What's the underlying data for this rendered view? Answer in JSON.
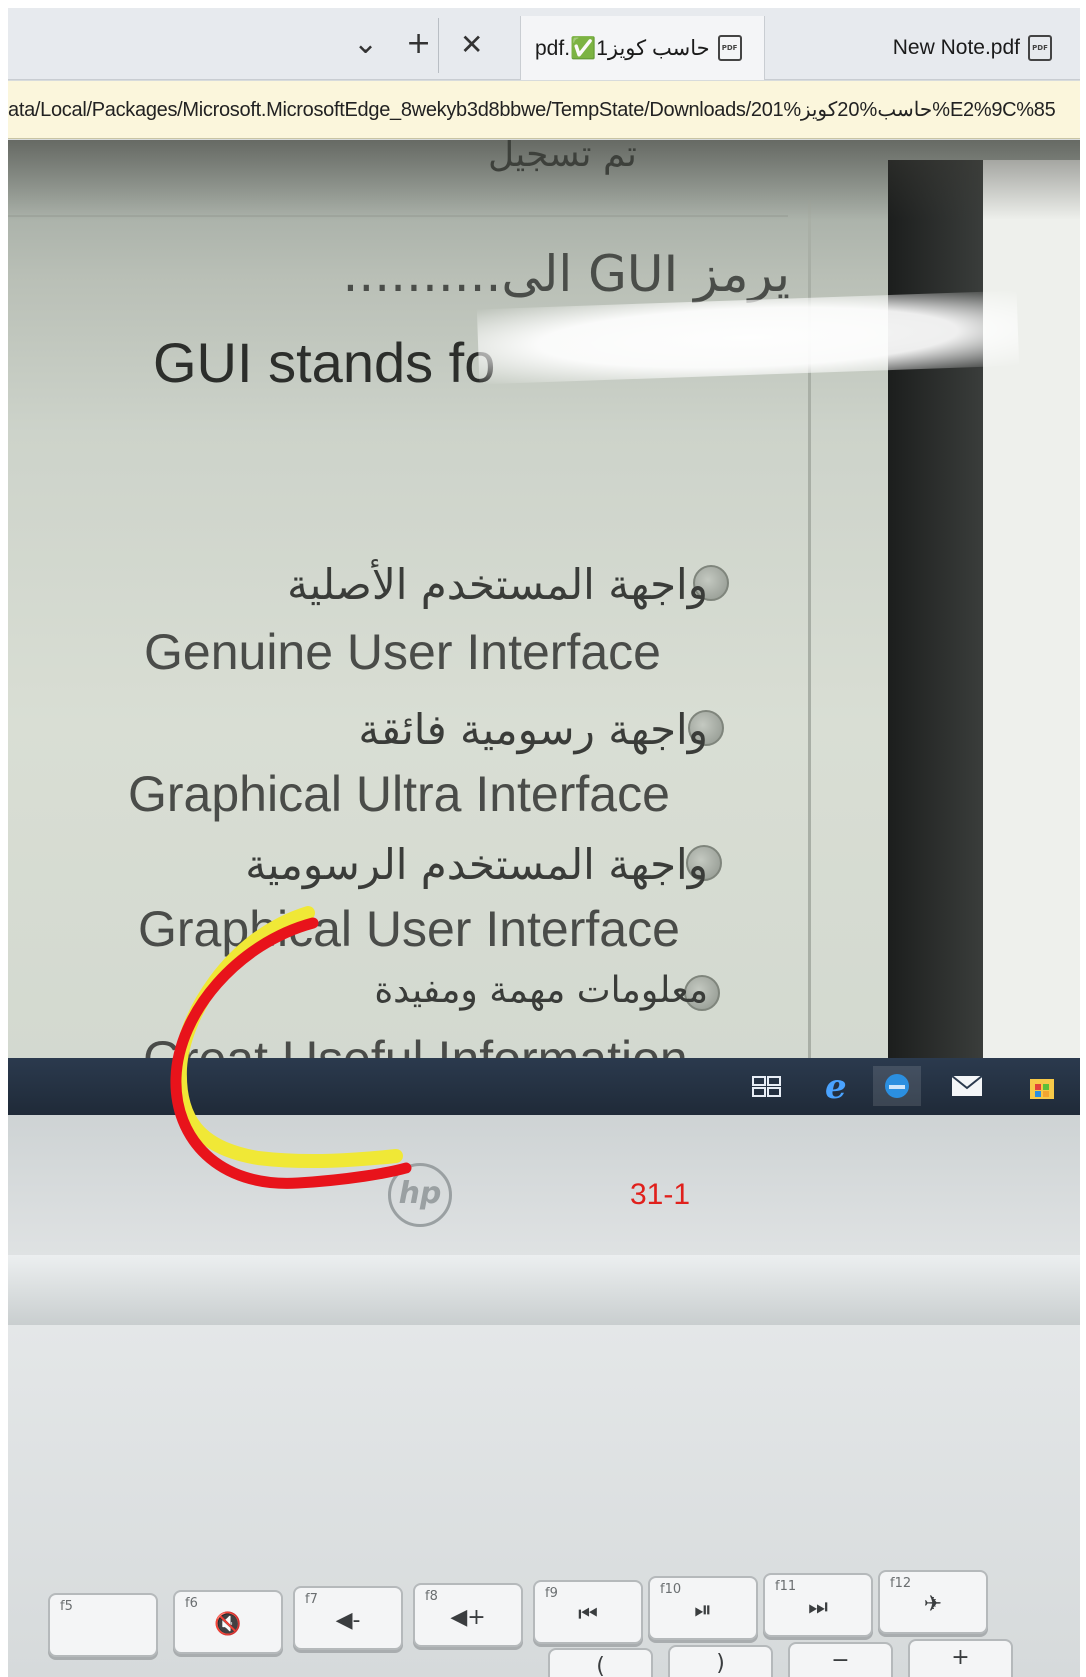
{
  "browser": {
    "tab_controls": {
      "tab_list": "⌄",
      "new_tab": "+",
      "close_tab": "✕"
    },
    "tabs": [
      {
        "label": "حاسب كويز1✅.pdf",
        "icon": "pdf-icon",
        "active": true
      },
      {
        "label": "New Note.pdf",
        "icon": "pdf-icon",
        "active": false
      }
    ],
    "pdf_icon_text": "PDF",
    "address": "ata/Local/Packages/Microsoft.MicrosoftEdge_8wekyb3d8bbwe/TempState/Downloads/201%حاسب%20كويز%E2%9C%85"
  },
  "screen": {
    "cropped_header": "تم تسجيل",
    "question_arabic": "يرمز GUI الى..........",
    "question_english": "GUI stands fo",
    "options": [
      {
        "arabic": "واجهة المستخدم الأصلية",
        "english": "Genuine User Interface"
      },
      {
        "arabic": "واجهة رسومية فائقة",
        "english": "Graphical Ultra Interface"
      },
      {
        "arabic": "واجهة المستخدم الرسومية",
        "english": "Graphical User Interface"
      },
      {
        "arabic": "معلومات مهمة ومفيدة",
        "english": "Great Useful Information"
      }
    ],
    "taskbar_icons": [
      "task-view-icon",
      "internet-explorer-icon",
      "edge-icon",
      "mail-icon",
      "store-icon"
    ]
  },
  "laptop": {
    "brand": "hp",
    "function_keys": [
      {
        "fn": "f5",
        "glyph": ""
      },
      {
        "fn": "f6",
        "glyph": "🔇"
      },
      {
        "fn": "f7",
        "glyph": "◀-"
      },
      {
        "fn": "f8",
        "glyph": "◀+"
      },
      {
        "fn": "f9",
        "glyph": "⏮"
      },
      {
        "fn": "f10",
        "glyph": "⏯"
      },
      {
        "fn": "f11",
        "glyph": "⏭"
      },
      {
        "fn": "f12",
        "glyph": "✈"
      }
    ],
    "second_row": [
      "(",
      ")",
      "−",
      "+"
    ]
  },
  "annotation": {
    "label": "31-1",
    "stroke_colors": {
      "outer": "#f0e836",
      "inner": "#e8131b"
    }
  }
}
